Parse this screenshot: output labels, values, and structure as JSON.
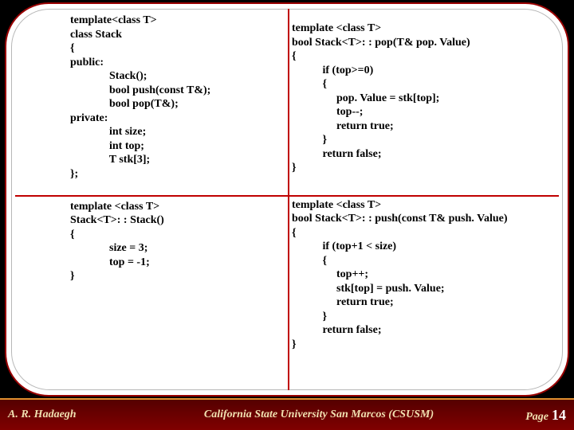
{
  "code": {
    "decl": "template<class T>\nclass Stack\n{\npublic:\n              Stack();\n              bool push(const T&);\n              bool pop(T&);\nprivate:\n              int size;\n              int top;\n              T stk[3];\n};",
    "pop": "template <class T>\nbool Stack<T>: : pop(T& pop. Value)\n{\n           if (top>=0)\n           {\n                pop. Value = stk[top];\n                top--;\n                return true;\n           }\n           return false;\n}",
    "ctor": "template <class T>\nStack<T>: : Stack()\n{\n              size = 3;\n              top = -1;\n}",
    "push": "template <class T>\nbool Stack<T>: : push(const T& push. Value)\n{\n           if (top+1 < size)\n           {\n                top++;\n                stk[top] = push. Value;\n                return true;\n           }\n           return false;\n}"
  },
  "footer": {
    "author": "A. R. Hadaegh",
    "affiliation": "California State University San Marcos (CSUSM)",
    "page_label": "Page",
    "page_number": "14"
  }
}
